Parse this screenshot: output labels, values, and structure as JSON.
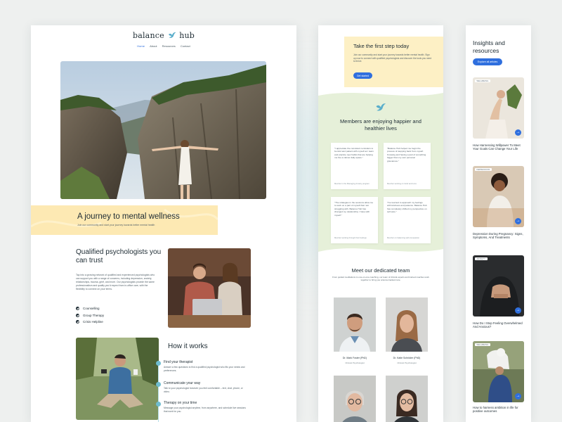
{
  "brand": {
    "name_part1": "balance",
    "name_part2": "hub",
    "accent_color": "#2f6fde",
    "highlight_color": "#fde9b3",
    "green_bg": "#e6f0d9"
  },
  "nav": {
    "items": [
      "Home",
      "About",
      "Resources",
      "Contact"
    ],
    "active": "Home"
  },
  "hero_banner": {
    "title": "A journey to mental wellness",
    "subtitle": "Join our community and start your journey towards better mental health"
  },
  "qualified": {
    "title": "Qualified psychologists you can trust",
    "body": "Tap into a growing network of qualified and experienced psychologists who can support you with a range of concerns, including depression, anxiety, relationships, trauma, grief, and more. Our psychologists provide the same professionalism and quality you'd expect from in-office care, with the flexibility to connect on your terms.",
    "features": [
      "Counselling",
      "Group Therapy",
      "Crisis Helpline"
    ]
  },
  "how_it_works": {
    "title": "How it works",
    "steps": [
      {
        "title": "Find your therapist",
        "desc": "Answer a few questions to find a qualified psychologist who fits your needs and preferences."
      },
      {
        "title": "Communicate your way",
        "desc": "Talk to your psychologist however you feel comfortable – text, chat, phone, or video."
      },
      {
        "title": "Therapy on your time",
        "desc": "Message your psychologist anytime, from anywhere, and schedule live sessions that work for you."
      }
    ]
  },
  "cta": {
    "title": "Take the first step today",
    "body": "Join our community and start your journey towards better mental health. Sign up now to connect with qualified psychologists and discover the tools you need to thrive.",
    "button": "Get started"
  },
  "members": {
    "title": "Members are enjoying happier and healthier lives",
    "testimonials": [
      {
        "quote": "\"I appreciate the consistent reminders to be kind and patient with myself as I learn and practice new habits that are helping me live a calmer daily space.\"",
        "author": "Member in the Managing Anxiety program"
      },
      {
        "quote": "\"Balance Hub helped me begin the process of stepping back from myself. Knowing and having a part of something bigger than my own personal grievances.\"",
        "author": "Member working on Grief and Loss"
      },
      {
        "quote": "\"The strategies in the sessions allow me to work on a part of myself that I am struggling with. Balance Hub has changed my relationship, I have with myself.\"",
        "author": "Member working through their feelings"
      },
      {
        "quote": "\"I've learned to approach my feelings with kindness and patience. Balance Hub has completely shifted my perspective on self-care.\"",
        "author": "Member on balancing self-compassion"
      }
    ]
  },
  "team": {
    "title": "Meet our dedicated team",
    "subtitle": "From guided meditations to one-on-one coaching, our team of clinical experts and trained coaches work together to bring you science-backed care.",
    "members": [
      {
        "name": "Dr. Mark Foster (PhD)",
        "role": "Clinical Psychologist"
      },
      {
        "name": "Dr. Katie Schröder (PhD)",
        "role": "Clinical Psychologist"
      },
      {
        "name": "",
        "role": ""
      },
      {
        "name": "",
        "role": ""
      }
    ]
  },
  "insights": {
    "title": "Insights and resources",
    "button": "Explore all articles",
    "articles": [
      {
        "tag": "WELLBEING",
        "title": "How Harnessing Willpower To Meet Your Goals Can Change Your Life"
      },
      {
        "tag": "DEPRESSION",
        "title": "Depression During Pregnancy: Signs, Symptoms, And Treatments"
      },
      {
        "tag": "ANXIETY",
        "title": "How Do I Stop Feeling Overwhelmed And Anxious?"
      },
      {
        "tag": "WELLBEING",
        "title": "How to harness ambition in life for positive outcomes"
      }
    ]
  }
}
